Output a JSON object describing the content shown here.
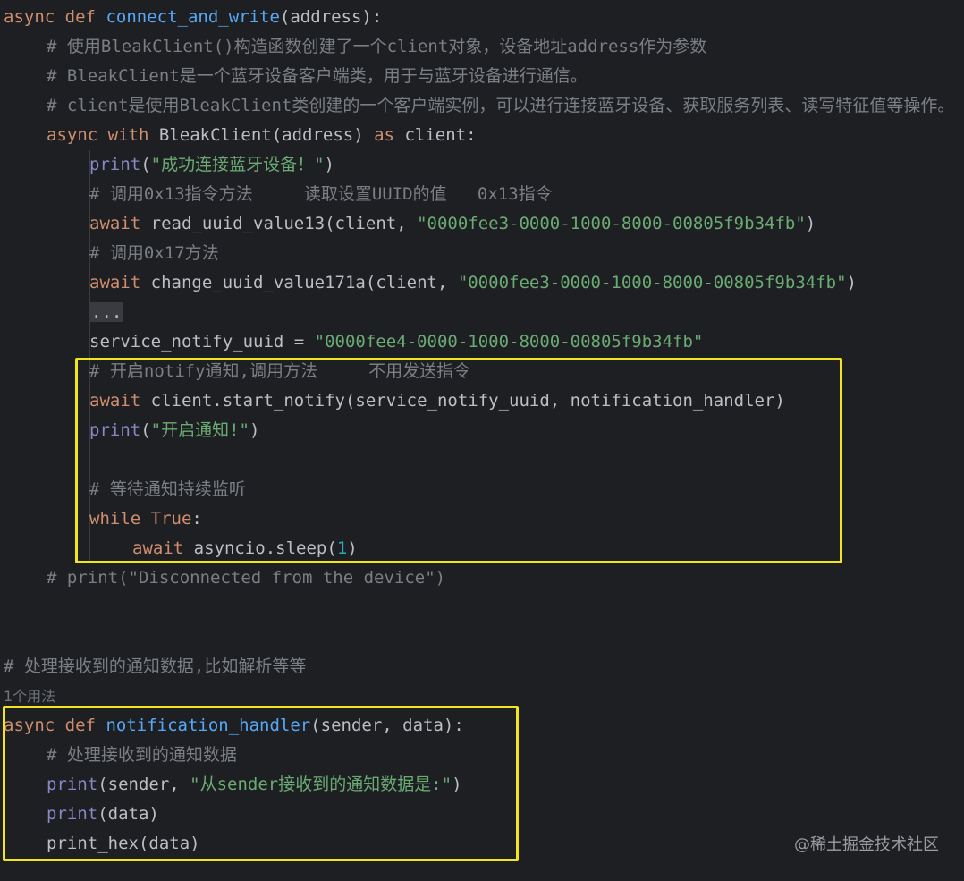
{
  "code": {
    "l1": {
      "kw1": "async",
      "kw2": "def",
      "name": "connect_and_write",
      "rest": "(address):"
    },
    "l2": "# 使用BleakClient()构造函数创建了一个client对象，设备地址address作为参数",
    "l3": "# BleakClient是一个蓝牙设备客户端类，用于与蓝牙设备进行通信。",
    "l4": "# client是使用BleakClient类创建的一个客户端实例，可以进行连接蓝牙设备、获取服务列表、读写特征值等操作。",
    "l5": {
      "kw1": "async",
      "kw2": "with",
      "mid": "BleakClient(address)",
      "kw3": "as",
      "rest": "client:"
    },
    "l6": {
      "fn": "print",
      "open": "(",
      "str": "\"成功连接蓝牙设备！\"",
      "close": ")"
    },
    "l7": "# 调用0x13指令方法     读取设置UUID的值   0x13指令",
    "l8": {
      "kw": "await",
      "mid": "read_uuid_value13(client, ",
      "str": "\"0000fee3-0000-1000-8000-00805f9b34fb\"",
      "close": ")"
    },
    "l9": "# 调用0x17方法",
    "l10": {
      "kw": "await",
      "mid": "change_uuid_value171a(client, ",
      "str": "\"0000fee3-0000-1000-8000-00805f9b34fb\"",
      "close": ")"
    },
    "l11": "...",
    "l12": {
      "mid": "service_notify_uuid = ",
      "str": "\"0000fee4-0000-1000-8000-00805f9b34fb\""
    },
    "l13": "# 开启notify通知,调用方法     不用发送指令",
    "l14": {
      "kw": "await",
      "mid": "client.start_notify(service_notify_uuid, notification_handler)"
    },
    "l15": {
      "fn": "print",
      "open": "(",
      "str": "\"开启通知!\"",
      "close": ")"
    },
    "l17": "# 等待通知持续监听",
    "l18": {
      "kw1": "while",
      "kw2": "True",
      "rest": ":"
    },
    "l19": {
      "kw": "await",
      "mid": "asyncio.sleep(",
      "num": "1",
      "close": ")"
    },
    "l20": "# print(\"Disconnected from the device\")",
    "l23": "# 处理接收到的通知数据,比如解析等等",
    "l24": "1个用法",
    "l25": {
      "kw1": "async",
      "kw2": "def",
      "name": "notification_handler",
      "rest": "(sender, data):"
    },
    "l26": "# 处理接收到的通知数据",
    "l27": {
      "fn": "print",
      "mid": "(sender, ",
      "str": "\"从sender接收到的通知数据是:\"",
      "close": ")"
    },
    "l28": {
      "fn": "print",
      "rest": "(data)"
    },
    "l29": {
      "rest": "print_hex(data)"
    }
  },
  "watermark": "@稀土掘金技术社区",
  "colors": {
    "background": "#1e1f22",
    "keyword": "#cf8e6d",
    "function": "#56a8f5",
    "string": "#6aab73",
    "number": "#2aacb8",
    "comment": "#7a7e85",
    "builtin": "#8888c6",
    "highlight": "#f2e51b"
  }
}
